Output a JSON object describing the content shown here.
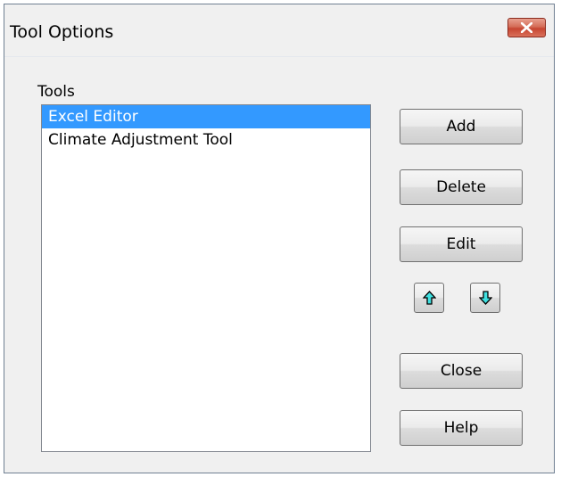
{
  "window": {
    "title": "Tool Options"
  },
  "tools": {
    "label": "Tools",
    "items": [
      {
        "label": "Excel Editor",
        "selected": true
      },
      {
        "label": "Climate Adjustment Tool",
        "selected": false
      }
    ]
  },
  "buttons": {
    "add": "Add",
    "delete": "Delete",
    "edit": "Edit",
    "close": "Close",
    "help": "Help"
  },
  "icons": {
    "title_close": "close-icon",
    "move_up": "arrow-up-icon",
    "move_down": "arrow-down-icon"
  },
  "colors": {
    "selection": "#3399ff",
    "arrow_fill": "#3fe0e0",
    "close_button": "#c74531"
  }
}
